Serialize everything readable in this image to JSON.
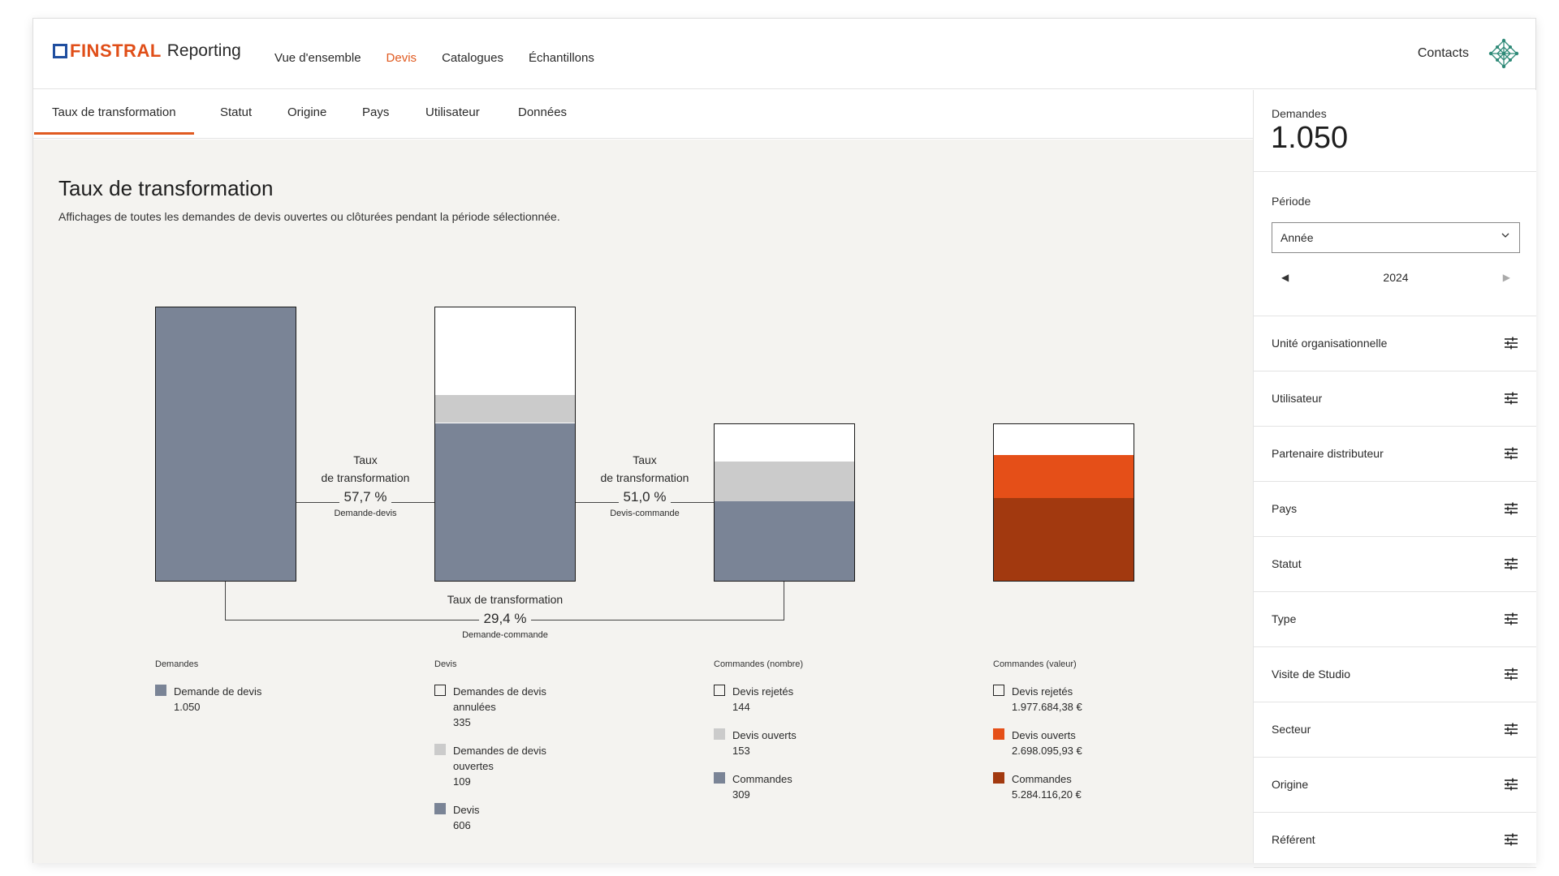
{
  "header": {
    "logo_brand": "FINSTRAL",
    "logo_product": "Reporting",
    "nav": [
      "Vue d'ensemble",
      "Devis",
      "Catalogues",
      "Échantillons"
    ],
    "active_nav": "Devis",
    "contacts": "Contacts"
  },
  "subnav": {
    "tabs": [
      "Taux de transformation",
      "Statut",
      "Origine",
      "Pays",
      "Utilisateur",
      "Données"
    ],
    "active": "Taux de transformation"
  },
  "main": {
    "title": "Taux de transformation",
    "description": "Affichages de toutes les demandes de devis ouvertes ou clôturées pendant la période sélectionnée."
  },
  "conversions": [
    {
      "label_1": "Taux",
      "label_2": "de transformation",
      "value": "57,7 %",
      "sub": "Demande-devis"
    },
    {
      "label_1": "Taux",
      "label_2": "de transformation",
      "value": "51,0 %",
      "sub": "Devis-commande"
    },
    {
      "label_1": "Taux de transformation",
      "value": "29,4 %",
      "sub": "Demande-commande"
    }
  ],
  "chart_data": {
    "type": "bar",
    "colors": {
      "slate": "#7a8496",
      "light_grey": "#cbcbcb",
      "white": "#ffffff",
      "orange": "#e54f18",
      "dark_orange": "#a2390f"
    },
    "bars": [
      {
        "title": "Demandes",
        "segments": [
          {
            "label": "Demande de devis",
            "value_text": "1.050",
            "value": 1050,
            "color": "#7a8496",
            "outline": false
          }
        ]
      },
      {
        "title": "Devis",
        "segments": [
          {
            "label": "Demandes de devis annulées",
            "value_text": "335",
            "value": 335,
            "color": "#ffffff",
            "outline": true
          },
          {
            "label": "Demandes de devis ouvertes",
            "value_text": "109",
            "value": 109,
            "color": "#cbcbcb",
            "outline": false
          },
          {
            "label": "Devis",
            "value_text": "606",
            "value": 606,
            "color": "#7a8496",
            "outline": false
          }
        ]
      },
      {
        "title": "Commandes (nombre)",
        "segments": [
          {
            "label": "Devis rejetés",
            "value_text": "144",
            "value": 144,
            "color": "#ffffff",
            "outline": true
          },
          {
            "label": "Devis ouverts",
            "value_text": "153",
            "value": 153,
            "color": "#cbcbcb",
            "outline": false
          },
          {
            "label": "Commandes",
            "value_text": "309",
            "value": 309,
            "color": "#7a8496",
            "outline": false
          }
        ]
      },
      {
        "title": "Commandes (valeur)",
        "segments": [
          {
            "label": "Devis rejetés",
            "value_text": "1.977.684,38 €",
            "value": 1977684.38,
            "color": "#ffffff",
            "outline": true
          },
          {
            "label": "Devis ouverts",
            "value_text": "2.698.095,93 €",
            "value": 2698095.93,
            "color": "#e54f18",
            "outline": false
          },
          {
            "label": "Commandes",
            "value_text": "5.284.116,20 €",
            "value": 5284116.2,
            "color": "#a2390f",
            "outline": false
          }
        ]
      }
    ]
  },
  "sidebar": {
    "demandes_label": "Demandes",
    "demandes_value": "1.050",
    "periode_label": "Période",
    "periode_value": "Année",
    "year": "2024",
    "filters": [
      "Unité organisationnelle",
      "Utilisateur",
      "Partenaire distributeur",
      "Pays",
      "Statut",
      "Type",
      "Visite de Studio",
      "Secteur",
      "Origine",
      "Référent"
    ]
  }
}
